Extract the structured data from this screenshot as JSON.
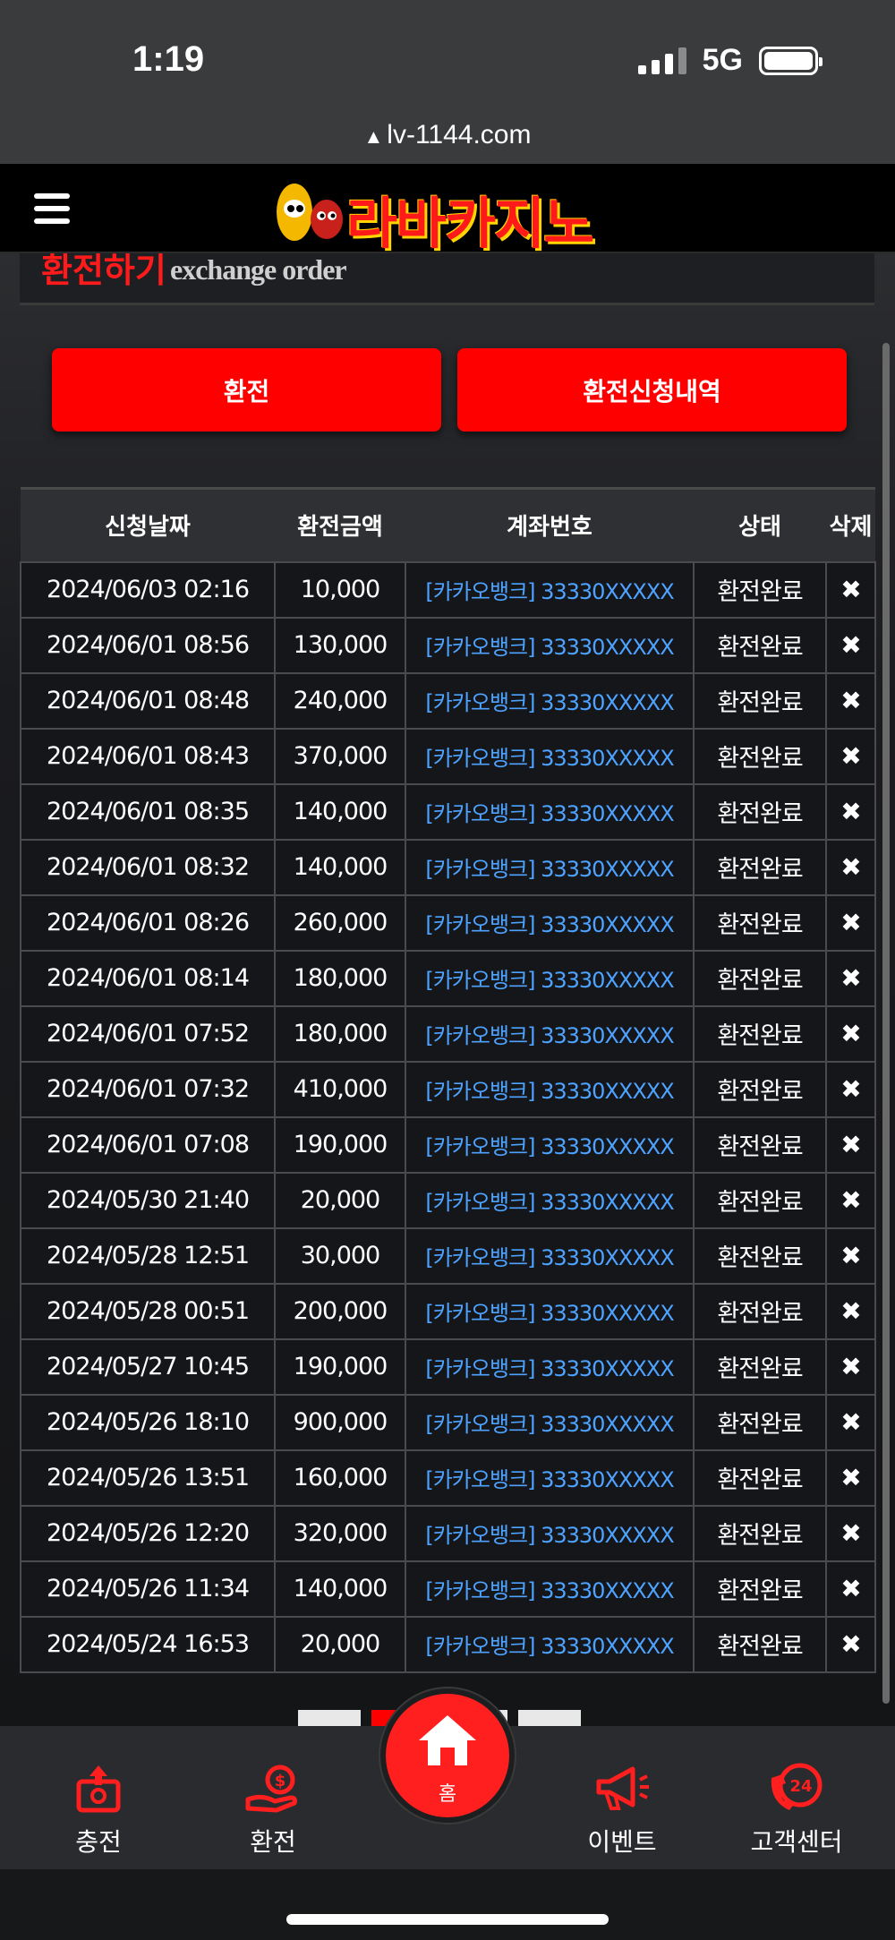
{
  "status_bar": {
    "time": "1:19",
    "network": "5G",
    "url": "lv-1144.com"
  },
  "header": {
    "logo_text": "라바카지노"
  },
  "page": {
    "title_ko": "환전하기",
    "title_en": "exchange order"
  },
  "buttons": {
    "exchange": "환전",
    "history": "환전신청내역"
  },
  "table": {
    "headers": [
      "신청날짜",
      "환전금액",
      "계좌번호",
      "상태",
      "삭제"
    ],
    "rows": [
      {
        "date": "2024/06/03 02:16",
        "amount": "10,000",
        "account": "[카카오뱅크] 33330XXXXX",
        "status": "환전완료",
        "delete": "✖"
      },
      {
        "date": "2024/06/01 08:56",
        "amount": "130,000",
        "account": "[카카오뱅크] 33330XXXXX",
        "status": "환전완료",
        "delete": "✖"
      },
      {
        "date": "2024/06/01 08:48",
        "amount": "240,000",
        "account": "[카카오뱅크] 33330XXXXX",
        "status": "환전완료",
        "delete": "✖"
      },
      {
        "date": "2024/06/01 08:43",
        "amount": "370,000",
        "account": "[카카오뱅크] 33330XXXXX",
        "status": "환전완료",
        "delete": "✖"
      },
      {
        "date": "2024/06/01 08:35",
        "amount": "140,000",
        "account": "[카카오뱅크] 33330XXXXX",
        "status": "환전완료",
        "delete": "✖"
      },
      {
        "date": "2024/06/01 08:32",
        "amount": "140,000",
        "account": "[카카오뱅크] 33330XXXXX",
        "status": "환전완료",
        "delete": "✖"
      },
      {
        "date": "2024/06/01 08:26",
        "amount": "260,000",
        "account": "[카카오뱅크] 33330XXXXX",
        "status": "환전완료",
        "delete": "✖"
      },
      {
        "date": "2024/06/01 08:14",
        "amount": "180,000",
        "account": "[카카오뱅크] 33330XXXXX",
        "status": "환전완료",
        "delete": "✖"
      },
      {
        "date": "2024/06/01 07:52",
        "amount": "180,000",
        "account": "[카카오뱅크] 33330XXXXX",
        "status": "환전완료",
        "delete": "✖"
      },
      {
        "date": "2024/06/01 07:32",
        "amount": "410,000",
        "account": "[카카오뱅크] 33330XXXXX",
        "status": "환전완료",
        "delete": "✖"
      },
      {
        "date": "2024/06/01 07:08",
        "amount": "190,000",
        "account": "[카카오뱅크] 33330XXXXX",
        "status": "환전완료",
        "delete": "✖"
      },
      {
        "date": "2024/05/30 21:40",
        "amount": "20,000",
        "account": "[카카오뱅크] 33330XXXXX",
        "status": "환전완료",
        "delete": "✖"
      },
      {
        "date": "2024/05/28 12:51",
        "amount": "30,000",
        "account": "[카카오뱅크] 33330XXXXX",
        "status": "환전완료",
        "delete": "✖"
      },
      {
        "date": "2024/05/28 00:51",
        "amount": "200,000",
        "account": "[카카오뱅크] 33330XXXXX",
        "status": "환전완료",
        "delete": "✖"
      },
      {
        "date": "2024/05/27 10:45",
        "amount": "190,000",
        "account": "[카카오뱅크] 33330XXXXX",
        "status": "환전완료",
        "delete": "✖"
      },
      {
        "date": "2024/05/26 18:10",
        "amount": "900,000",
        "account": "[카카오뱅크] 33330XXXXX",
        "status": "환전완료",
        "delete": "✖"
      },
      {
        "date": "2024/05/26 13:51",
        "amount": "160,000",
        "account": "[카카오뱅크] 33330XXXXX",
        "status": "환전완료",
        "delete": "✖"
      },
      {
        "date": "2024/05/26 12:20",
        "amount": "320,000",
        "account": "[카카오뱅크] 33330XXXXX",
        "status": "환전완료",
        "delete": "✖"
      },
      {
        "date": "2024/05/26 11:34",
        "amount": "140,000",
        "account": "[카카오뱅크] 33330XXXXX",
        "status": "환전완료",
        "delete": "✖"
      },
      {
        "date": "2024/05/24 16:53",
        "amount": "20,000",
        "account": "[카카오뱅크] 33330XXXXX",
        "status": "환전완료",
        "delete": "✖"
      }
    ]
  },
  "bottom_nav": {
    "deposit": "충전",
    "exchange": "환전",
    "home": "홈",
    "event": "이벤트",
    "support": "고객센터",
    "support_badge": "24"
  },
  "colors": {
    "accent": "#ff0000",
    "link": "#4da3ff",
    "background": "#141517"
  }
}
